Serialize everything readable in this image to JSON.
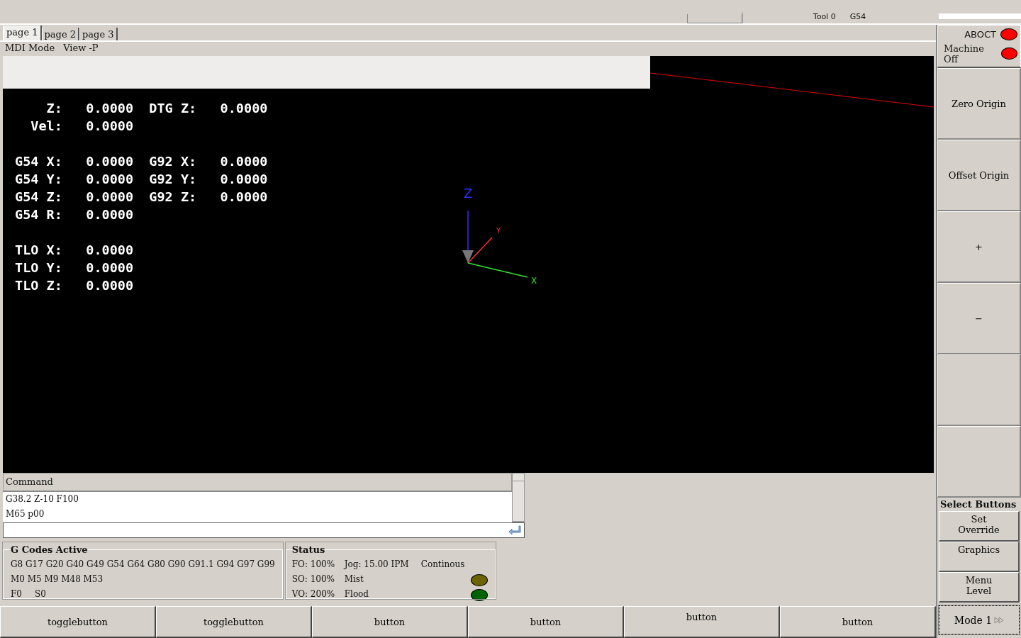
{
  "top_bar": {
    "tool": "Tool 0",
    "offset": "G54"
  },
  "tabs": [
    {
      "label": "page 1",
      "selected": true
    },
    {
      "label": "page 2",
      "selected": false
    },
    {
      "label": "page 3",
      "selected": false
    }
  ],
  "menu": [
    "MDI Mode",
    "View -P"
  ],
  "dro": {
    "groups": [
      [
        "    Z:   0.0000  DTG Z:   0.0000",
        "  Vel:   0.0000"
      ],
      [
        "G54 X:   0.0000  G92 X:   0.0000",
        "G54 Y:   0.0000  G92 Y:   0.0000",
        "G54 Z:   0.0000  G92 Z:   0.0000",
        "G54 R:   0.0000"
      ],
      [
        "TLO X:   0.0000",
        "TLO Y:   0.0000",
        "TLO Z:   0.0000"
      ]
    ]
  },
  "axes": {
    "z": "Z",
    "y": "Y",
    "x": "X"
  },
  "command": {
    "header": "Command",
    "history": [
      "G38.2 Z-10 F100",
      "M65 p00"
    ]
  },
  "gcodes": {
    "title": "G Codes Active",
    "lines": [
      "G8 G17 G20 G40 G49 G54 G64 G80 G90 G91.1 G94 G97 G99",
      "M0 M5 M9 M48 M53"
    ],
    "feed": "F0",
    "speed": "S0"
  },
  "status": {
    "title": "Status",
    "fo": "FO: 100%",
    "so": "SO: 100%",
    "vo": "VO: 200%",
    "jog": "Jog: 15.00 IPM",
    "jog_mode": "Continous",
    "indicators": [
      {
        "label": "Mist",
        "color": "#6b6400"
      },
      {
        "label": "Flood",
        "color": "#006400"
      }
    ]
  },
  "machine_state": [
    {
      "label": "ABOCT",
      "color": "#ff0000"
    },
    {
      "label": "Machine Off",
      "color": "#ff0000"
    }
  ],
  "side_buttons": [
    "Zero Origin",
    "Offset Origin",
    "+",
    "−"
  ],
  "select_buttons": {
    "title": "Select Buttons",
    "buttons": [
      "Set\nOverride",
      "Graphics",
      "Menu\nLevel"
    ]
  },
  "bottom_buttons": [
    "togglebutton",
    "togglebutton",
    "button",
    "button",
    "button",
    "button"
  ],
  "mode_button": "Mode 1"
}
